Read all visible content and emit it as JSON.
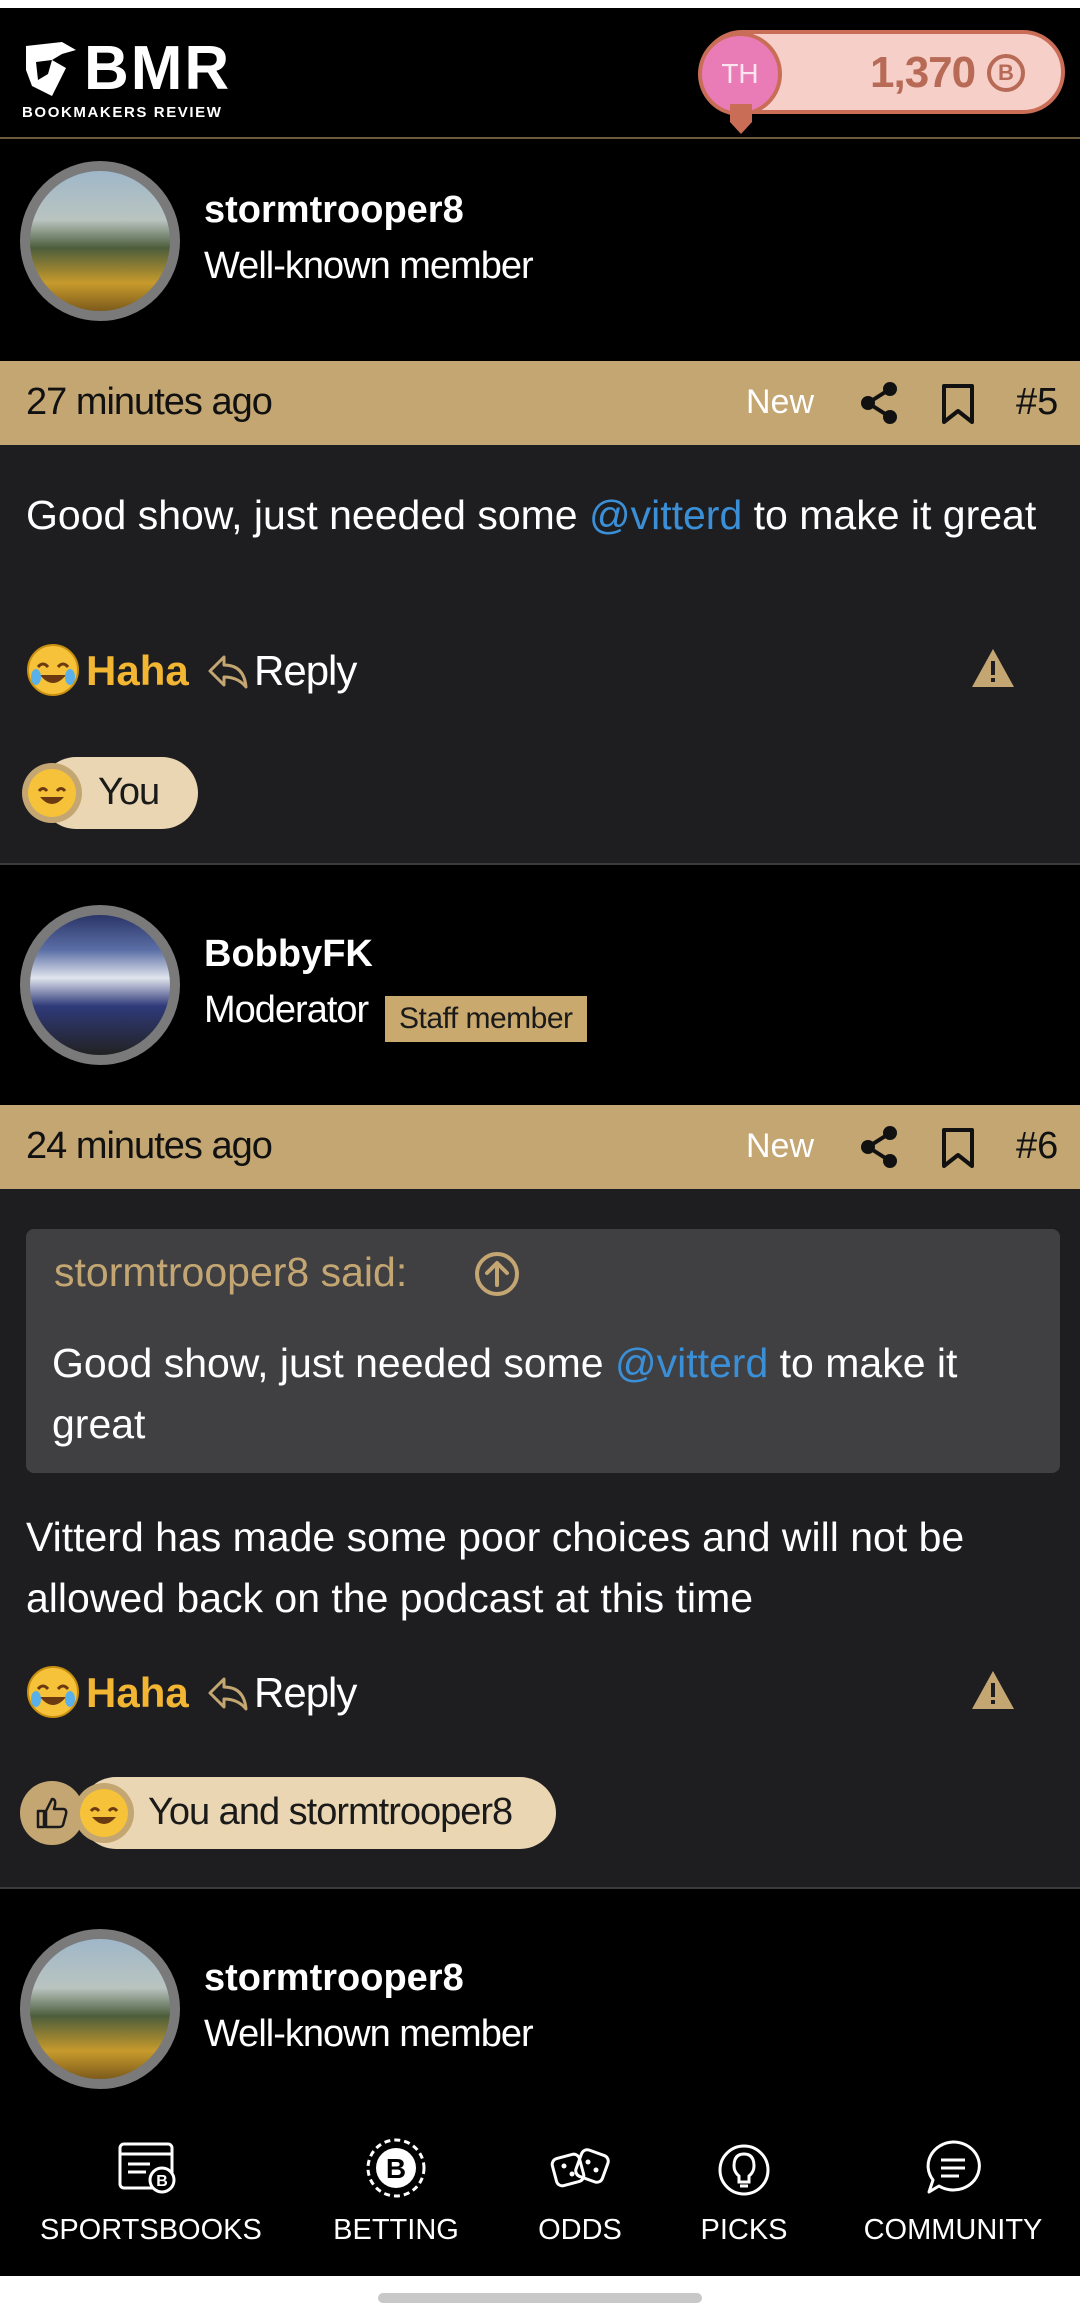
{
  "brand": {
    "name": "BMR",
    "tagline": "BOOKMAKERS REVIEW"
  },
  "account": {
    "initials": "TH",
    "points": "1,370",
    "coin_symbol": "B"
  },
  "posts": [
    {
      "username": "stormtrooper8",
      "title": "Well-known member",
      "time": "27 minutes ago",
      "new_label": "New",
      "number": "#5",
      "message_before": "Good show, just needed some ",
      "mention": "@vitterd",
      "message_after": " to make it great",
      "haha_label": "Haha",
      "reply_label": "Reply",
      "reaction_summary": "You"
    },
    {
      "username": "BobbyFK",
      "title": "Moderator",
      "badge": "Staff member",
      "time": "24 minutes ago",
      "new_label": "New",
      "number": "#6",
      "quote_author": "stormtrooper8 said:",
      "quote_before": "Good show, just needed some ",
      "quote_mention": "@vitterd",
      "quote_after": " to make it great",
      "message": "Vitterd has made some poor choices and will not be allowed back on the podcast at this time",
      "haha_label": "Haha",
      "reply_label": "Reply",
      "reaction_summary": "You and stormtrooper8"
    },
    {
      "username": "stormtrooper8",
      "title": "Well-known member"
    }
  ],
  "nav": [
    {
      "label": "SPORTSBOOKS",
      "icon": "sportsbooks-icon"
    },
    {
      "label": "BETTING",
      "icon": "betting-icon"
    },
    {
      "label": "ODDS",
      "icon": "odds-icon"
    },
    {
      "label": "PICKS",
      "icon": "picks-icon"
    },
    {
      "label": "COMMUNITY",
      "icon": "community-icon"
    }
  ],
  "colors": {
    "accent_gold": "#c4a672",
    "mention_blue": "#3b8fd6",
    "haha_yellow": "#f2b632",
    "points_pill": "#f7cfc9"
  }
}
